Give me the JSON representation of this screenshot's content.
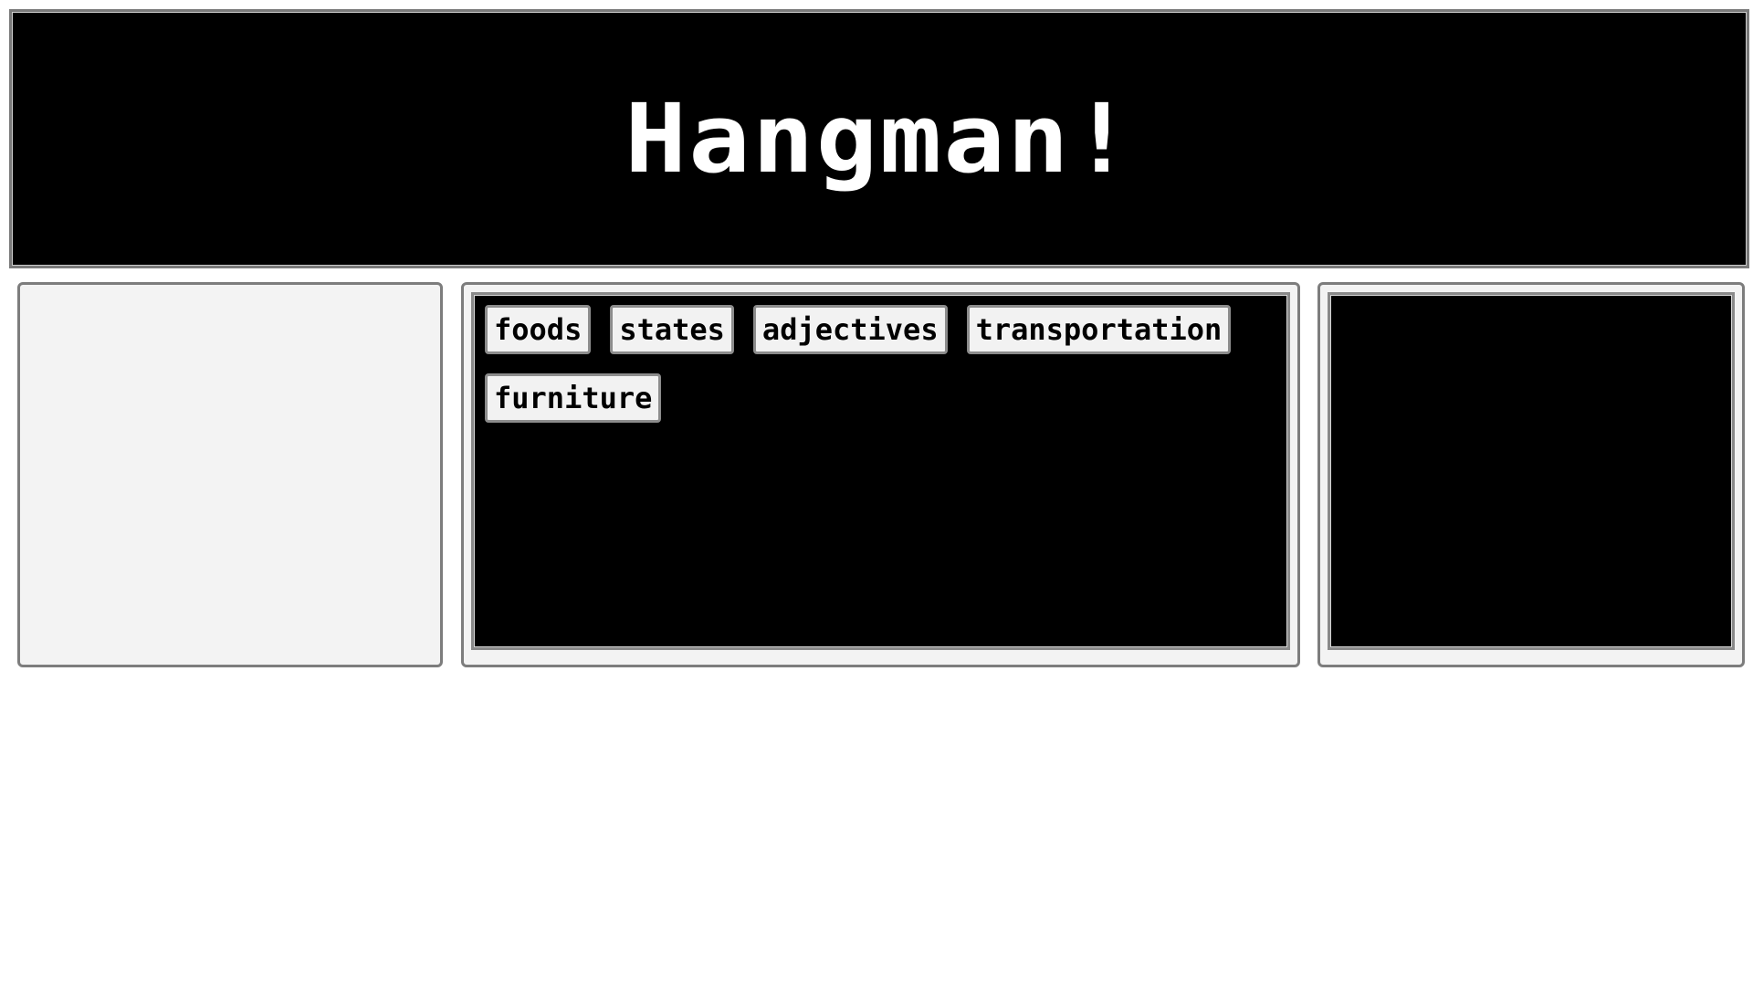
{
  "header": {
    "title": "Hangman!"
  },
  "categories": [
    {
      "label": "foods"
    },
    {
      "label": "states"
    },
    {
      "label": "adjectives"
    },
    {
      "label": "transportation"
    },
    {
      "label": "furniture"
    }
  ],
  "colors": {
    "background": "#ffffff",
    "screen": "#000000",
    "panel": "#f3f3f3",
    "border": "#7d7d7d",
    "button": "#f2f2f2"
  }
}
